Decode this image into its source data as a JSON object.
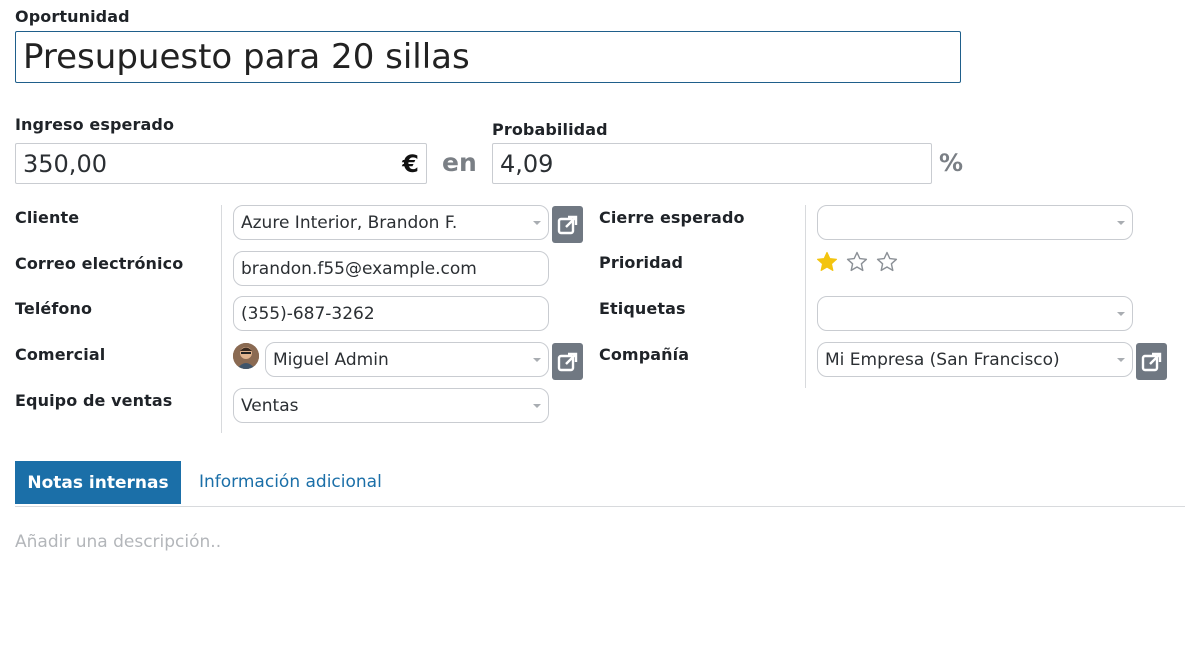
{
  "opportunity": {
    "label": "Oportunidad",
    "value": "Presupuesto para 20 sillas"
  },
  "revenue": {
    "label": "Ingreso esperado",
    "value": "350,00",
    "currency_symbol": "€",
    "connector": "en"
  },
  "probability": {
    "label": "Probabilidad",
    "value": "4,09",
    "unit": "%"
  },
  "left_fields": {
    "client": {
      "label": "Cliente",
      "value": "Azure Interior, Brandon F."
    },
    "email": {
      "label": "Correo electrónico",
      "value": "brandon.f55@example.com"
    },
    "phone": {
      "label": "Teléfono",
      "value": "(355)-687-3262"
    },
    "salesperson": {
      "label": "Comercial",
      "value": "Miguel Admin"
    },
    "sales_team": {
      "label": "Equipo de ventas",
      "value": "Ventas"
    }
  },
  "right_fields": {
    "expected_close": {
      "label": "Cierre esperado",
      "value": ""
    },
    "priority": {
      "label": "Prioridad",
      "stars_filled": 1,
      "stars_total": 3
    },
    "tags": {
      "label": "Etiquetas",
      "value": ""
    },
    "company": {
      "label": "Compañía",
      "value": "Mi Empresa (San Francisco)"
    }
  },
  "tabs": {
    "active": "Notas internas",
    "other": "Información adicional"
  },
  "notes": {
    "placeholder": "Añadir una descripción.."
  },
  "colors": {
    "accent": "#1b6fa8",
    "star_filled": "#f3c40f",
    "button_grey": "#707882"
  },
  "icons": {
    "external_link": "external-link-icon",
    "priority_star": "star-icon",
    "dropdown": "caret-down-icon"
  }
}
